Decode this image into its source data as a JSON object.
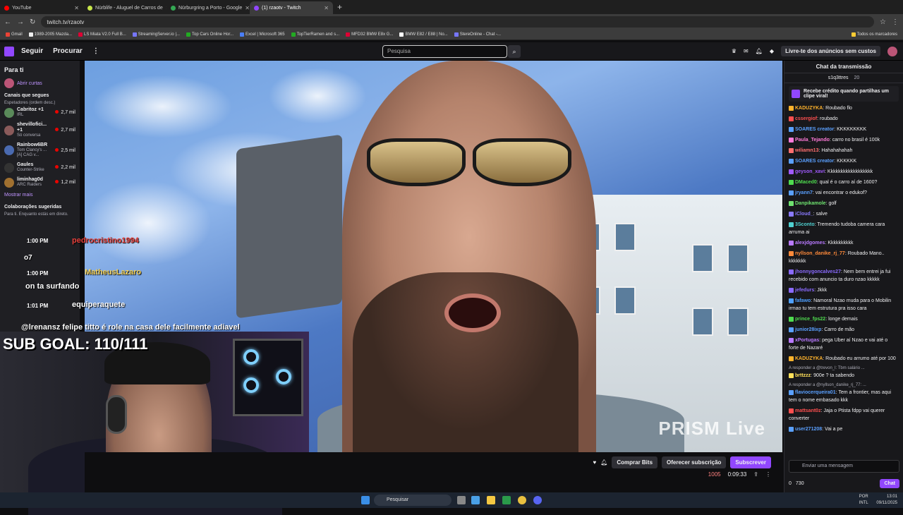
{
  "browser": {
    "tabs": [
      {
        "label": "YouTube",
        "color": "#ff0000",
        "active": false
      },
      {
        "label": "Nürblife - Aluguel de Carros de",
        "color": "#c8e64a",
        "active": false
      },
      {
        "label": "Nürburgring a Porto - Google",
        "color": "#34a853",
        "active": false
      },
      {
        "label": "(1) rzaotv - Twitch",
        "color": "#9147ff",
        "active": true
      }
    ],
    "url": "twitch.tv/rzaotv",
    "bookmarks": [
      "Gmail",
      "1989-2005 Mazda...",
      "LS Miata V2.0 Full B...",
      "StreamingServer.io |...",
      "Top Cars Online Hor...",
      "Excel | Microsoft 365",
      "TopTierRamen and s...",
      "MFD32 BMW E8x G...",
      "BMW E82 / E88 | No...",
      "StereOnline - Chat -..."
    ],
    "bookmarks_folder": "Todos os marcadores"
  },
  "twitch": {
    "follow": "Seguir",
    "browse": "Procurar",
    "search_placeholder": "Pesquisa",
    "prime": "Livre-te dos anúncios sem custos",
    "notif_count": "1"
  },
  "sidebar": {
    "title": "Para ti",
    "open_clips": "Abrir curtas",
    "followed_title": "Canais que segues",
    "followed_sub": "Espetadores (ordem desc.)",
    "channels": [
      {
        "name": "Cabritoz +1",
        "game": "IRL",
        "viewers": "2,7 mil",
        "color": "#5a8a5a"
      },
      {
        "name": "shevillofici... +1",
        "game": "Só conversa",
        "viewers": "2,7 mil",
        "color": "#8a5a5a"
      },
      {
        "name": "Rainbow6BR",
        "game": "Tom Clancy's ...",
        "extra": "[A] CAG v...",
        "viewers": "2,5 mil",
        "color": "#4a6ab0"
      },
      {
        "name": "Gaules",
        "game": "Counter-Strike",
        "viewers": "2,2 mil",
        "color": "#333"
      },
      {
        "name": "liminhag0d",
        "game": "ARC Raiders",
        "viewers": "1,2 mil",
        "color": "#a07030"
      }
    ],
    "show_more": "Mostrar mais",
    "collab_title": "Colaborações sugeridas",
    "collab_sub": "Para ti. Enquanto estás em direto."
  },
  "overlay": {
    "sub_goal": "SUB GOAL: 110/111",
    "events": [
      {
        "time": "1:00 PM",
        "name": "pedrocristino1994"
      },
      {
        "time": "1:00 PM",
        "name": "MatheusLazaro"
      },
      {
        "time": "1:01 PM",
        "name": "equiperaquete"
      }
    ],
    "caption1": "on ta surfando",
    "caption2": "@lrenansz felipe titto é role na casa dele facilmente adiavel",
    "caption3": "o7",
    "prism": "PRISM Live"
  },
  "player": {
    "buy_bits": "Comprar Bits",
    "gift_sub": "Oferecer subscrição",
    "subscribe": "Subscrever",
    "viewers": "1005",
    "uptime": "0:09:33"
  },
  "chat": {
    "title": "Chat da transmissão",
    "pinned_user": "s1q3ttres",
    "pinned_count": "20",
    "clip_promo": "Recebe crédito quando partilhas um clipe viral!",
    "messages": [
      {
        "user": "KADUZYKA",
        "color": "#ffb32c",
        "text": "Roubado flo"
      },
      {
        "user": "cssergiof",
        "color": "#ff4f4f",
        "text": "roubado"
      },
      {
        "user": "SOARES creator",
        "color": "#5aa0ff",
        "text": "KKKKKKKKK"
      },
      {
        "user": "Paula_Tejando",
        "color": "#ff7ad9",
        "text": "carro no brasil é 100k"
      },
      {
        "user": "wiliamn13",
        "color": "#ff6f6f",
        "text": "Hahahahahah"
      },
      {
        "user": "SOARES creator",
        "color": "#5aa0ff",
        "text": "KKKKKK"
      },
      {
        "user": "geyson_xavi",
        "color": "#a15aff",
        "text": "Kkkkkkkkkkkkkkkkkk"
      },
      {
        "user": "DMaced0",
        "color": "#4fdc4f",
        "text": "qual é o carro aí de 1600?"
      },
      {
        "user": "jryann7",
        "color": "#5aa0ff",
        "text": "vai encontrar o edukof?"
      },
      {
        "user": "Danpikamole",
        "color": "#6fe36f",
        "text": "golf"
      },
      {
        "user": "iCloud_",
        "color": "#8a7aff",
        "text": "salve"
      },
      {
        "user": "3Sconto",
        "color": "#4fd0d0",
        "text": "Tremendo tudoba camera cara arruma ai"
      },
      {
        "user": "alexjdgomes",
        "color": "#b97aff",
        "text": "Kkkkkkkkkk"
      },
      {
        "user": "nyllson_danike_rj_77",
        "color": "#ff8a3a",
        "text": "Roubado Mano.. kkkkkkk"
      },
      {
        "user": "jhonnygoncalves27",
        "color": "#8a6aff",
        "text": "Nem bem entrei ja fui recebido com anuncio ta duro nzao kkkkk"
      },
      {
        "user": "jefedurs",
        "color": "#8a6aff",
        "text": "Jkkk"
      },
      {
        "user": "fafawo",
        "color": "#4fa0ff",
        "text": "Namoral Nzao muda para o Mobilin irmao tu tem estrutura pra isso cara"
      },
      {
        "user": "prince_fps22",
        "color": "#4fdc4f",
        "text": "longe demais"
      },
      {
        "user": "junior28ixp",
        "color": "#5aa0ff",
        "text": "Carro de mão"
      },
      {
        "user": "xPortugas",
        "color": "#b97aff",
        "text": "pega Uber aí Nzao e vai até o forte de Nazaré"
      },
      {
        "user": "KADUZYKA",
        "color": "#ffb32c",
        "text": "Roubado eu arrumo até por 100"
      }
    ],
    "reply1": "A responder a @trevon_l: Tbm salário ...",
    "reply1_msg": {
      "user": "brttzzz",
      "color": "#ffe05a",
      "text": "900e ? ta sabendo"
    },
    "reply2": "A responder a @nyllson_danike_rj_77: ...",
    "reply2_msg": {
      "user": "flaviocerqueira01",
      "color": "#5aa0ff",
      "text": "Tem a frontier, mas aqui tem o nome embasado kkk"
    },
    "last_msgs": [
      {
        "user": "mattsant0z",
        "color": "#ff4f4f",
        "text": "Jaja o Ptista fdpp vai querer converter"
      },
      {
        "user": "user271208",
        "color": "#5aa0ff",
        "text": "Vai a pe"
      }
    ],
    "input_placeholder": "Enviar uma mensagem",
    "bits": "0",
    "points": "730",
    "send": "Chat"
  },
  "taskbar": {
    "search": "Pesquisar",
    "lang": "POR",
    "lang2": "INTL",
    "time": "13:01",
    "date": "09/11/2025"
  }
}
